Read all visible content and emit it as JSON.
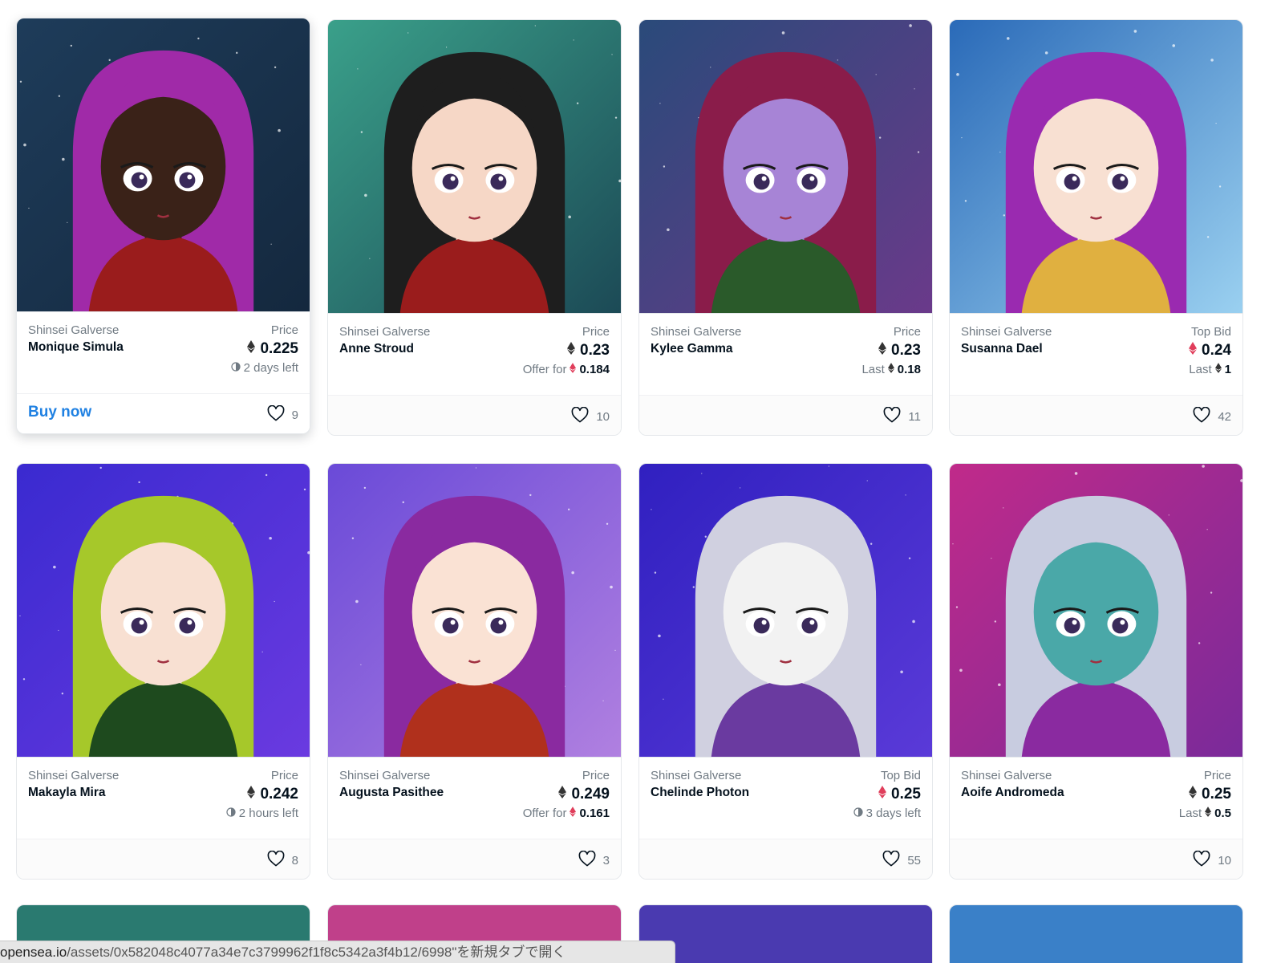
{
  "colors": {
    "accent": "#2081e2",
    "text": "#04111d",
    "muted": "#707a83",
    "eth_black": "#343434",
    "weth_red": "#e03e5b",
    "border": "#e5e8eb"
  },
  "cards": [
    {
      "collection": "Shinsei Galverse",
      "name": "Monique Simula",
      "price_label": "Price",
      "price": "0.225",
      "price_currency": "eth-icon",
      "sub_prefix": "",
      "sub_value": "2 days left",
      "sub_icon": "clock-icon",
      "likes": "9",
      "action": "Buy now",
      "hovered": true,
      "art": {
        "bg1": "#1e3c5a",
        "bg2": "#14283e",
        "skin": "#3a2218",
        "hair": "#a02aa8",
        "top": "#9a1c1c"
      }
    },
    {
      "collection": "Shinsei Galverse",
      "name": "Anne Stroud",
      "price_label": "Price",
      "price": "0.23",
      "price_currency": "eth-icon",
      "sub_prefix": "Offer for",
      "sub_value": "0.184",
      "sub_icon": "weth-icon",
      "likes": "10",
      "action": "",
      "hovered": false,
      "art": {
        "bg1": "#3aa08a",
        "bg2": "#1c4a56",
        "skin": "#f6d7c6",
        "hair": "#1e1e1e",
        "top": "#9a1c1c"
      }
    },
    {
      "collection": "Shinsei Galverse",
      "name": "Kylee Gamma",
      "price_label": "Price",
      "price": "0.23",
      "price_currency": "eth-icon",
      "sub_prefix": "Last",
      "sub_value": "0.18",
      "sub_icon": "eth-icon",
      "likes": "11",
      "action": "",
      "hovered": false,
      "art": {
        "bg1": "#2a4a7a",
        "bg2": "#6a3a8a",
        "skin": "#a784d6",
        "hair": "#8a1c4a",
        "top": "#2a5a2a"
      }
    },
    {
      "collection": "Shinsei Galverse",
      "name": "Susanna Dael",
      "price_label": "Top Bid",
      "price": "0.24",
      "price_currency": "weth-icon",
      "sub_prefix": "Last",
      "sub_value": "1",
      "sub_icon": "eth-icon",
      "likes": "42",
      "action": "",
      "hovered": false,
      "art": {
        "bg1": "#2a6ab8",
        "bg2": "#9ad0f0",
        "skin": "#f8e0d2",
        "hair": "#9a2ab0",
        "top": "#e0b040"
      }
    },
    {
      "collection": "Shinsei Galverse",
      "name": "Makayla Mira",
      "price_label": "Price",
      "price": "0.242",
      "price_currency": "eth-icon",
      "sub_prefix": "",
      "sub_value": "2 hours left",
      "sub_icon": "clock-icon",
      "likes": "8",
      "action": "",
      "hovered": false,
      "art": {
        "bg1": "#3a2ad0",
        "bg2": "#6a3ae0",
        "skin": "#f8e0d2",
        "hair": "#a6c82a",
        "top": "#1e4a1e"
      }
    },
    {
      "collection": "Shinsei Galverse",
      "name": "Augusta Pasithee",
      "price_label": "Price",
      "price": "0.249",
      "price_currency": "eth-icon",
      "sub_prefix": "Offer for",
      "sub_value": "0.161",
      "sub_icon": "weth-icon",
      "likes": "3",
      "action": "",
      "hovered": false,
      "art": {
        "bg1": "#6a4ad8",
        "bg2": "#b080e0",
        "skin": "#fae2d4",
        "hair": "#8a2aa0",
        "top": "#b0301c"
      }
    },
    {
      "collection": "Shinsei Galverse",
      "name": "Chelinde Photon",
      "price_label": "Top Bid",
      "price": "0.25",
      "price_currency": "weth-icon",
      "sub_prefix": "",
      "sub_value": "3 days left",
      "sub_icon": "clock-icon",
      "likes": "55",
      "action": "",
      "hovered": false,
      "art": {
        "bg1": "#3020c0",
        "bg2": "#5a3ad8",
        "skin": "#f2f2f2",
        "hair": "#d0d0e0",
        "top": "#6a3aa0"
      }
    },
    {
      "collection": "Shinsei Galverse",
      "name": "Aoife Andromeda",
      "price_label": "Price",
      "price": "0.25",
      "price_currency": "eth-icon",
      "sub_prefix": "Last",
      "sub_value": "0.5",
      "sub_icon": "eth-icon",
      "likes": "10",
      "action": "",
      "hovered": false,
      "art": {
        "bg1": "#c02a8a",
        "bg2": "#7a2a9a",
        "skin": "#4aa8a8",
        "hair": "#c8cce0",
        "top": "#8a2aa0"
      }
    }
  ],
  "partial_row": [
    {
      "bg": "#2a7a70"
    },
    {
      "bg": "#c0408a"
    },
    {
      "bg": "#4a3ab0"
    },
    {
      "bg": "#3a80c8"
    }
  ],
  "status_bar": {
    "host": "opensea.io",
    "rest": "/assets/0x582048c4077a34e7c3799962f1f8c5342a3f4b12/6998\"を新規タブで開く"
  }
}
